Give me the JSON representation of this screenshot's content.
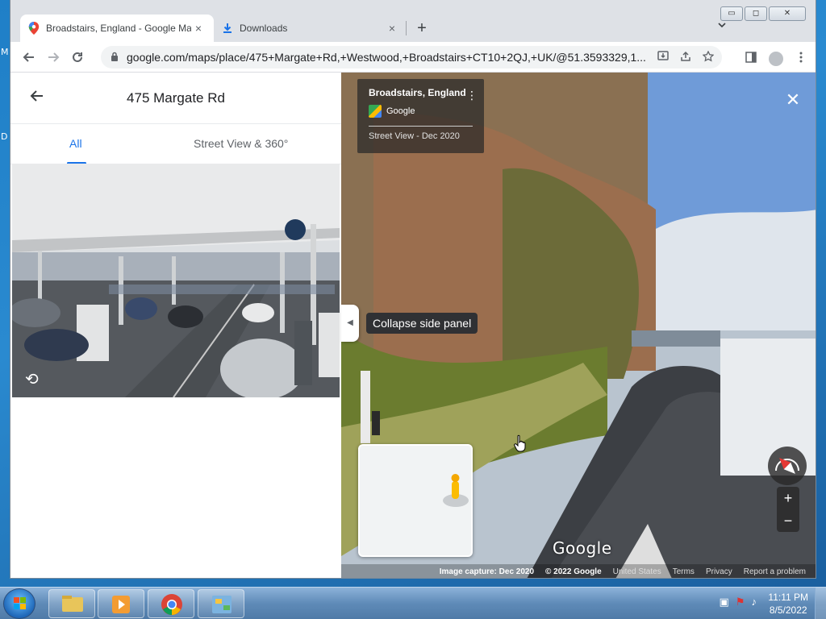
{
  "desktop": {
    "peek_text_1": "M",
    "peek_text_2": "D"
  },
  "browser": {
    "tabs": [
      {
        "title": "Broadstairs, England - Google Maps",
        "close": "×"
      },
      {
        "title": "Downloads",
        "close": "×"
      }
    ],
    "new_tab": "+",
    "window_controls": {
      "minimize": "▭",
      "maximize": "◻",
      "close": "✕"
    },
    "url": "google.com/maps/place/475+Margate+Rd,+Westwood,+Broadstairs+CT10+2QJ,+UK/@51.3593329,1..."
  },
  "side_panel": {
    "title": "475 Margate Rd",
    "tabs": [
      {
        "label": "All",
        "active": true
      },
      {
        "label": "Street View & 360°",
        "active": false
      }
    ]
  },
  "tooltip": "Collapse side panel",
  "street_view": {
    "place": "Broadstairs, England",
    "provider": "Google",
    "date": "Street View - Dec 2020",
    "watermark": "Google",
    "footer": {
      "capture": "Image capture: Dec 2020",
      "copyright": "© 2022 Google",
      "region": "United States",
      "terms": "Terms",
      "privacy": "Privacy",
      "report": "Report a problem"
    },
    "zoom_in": "+",
    "zoom_out": "−"
  },
  "taskbar": {
    "time": "11:11 PM",
    "date": "8/5/2022"
  },
  "icons": [
    "maps-favicon",
    "download-icon",
    "back-arrow-icon",
    "forward-arrow-icon",
    "reload-icon",
    "lock-icon",
    "install-icon",
    "share-icon",
    "star-icon",
    "side-panel-icon",
    "profile-icon",
    "menu-icon",
    "rotate-360-icon",
    "compass-icon",
    "pegman-icon"
  ],
  "colors": {
    "accent": "#1a73e8",
    "tooltip_bg": "#303134",
    "tab_strip": "#dee1e6"
  }
}
